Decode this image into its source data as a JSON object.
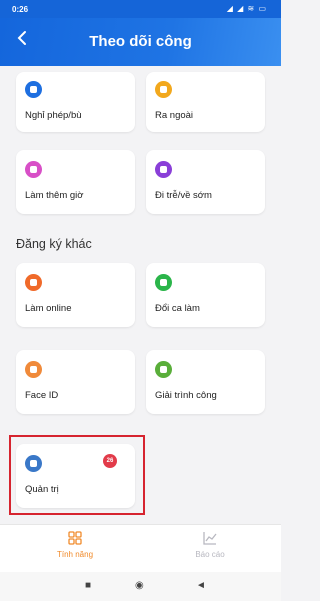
{
  "status_bar": {
    "time": "0:26",
    "icons": "signal wifi battery"
  },
  "app_bar": {
    "title": "Theo dõi công",
    "back_icon": "chevron-left-icon"
  },
  "cards": [
    {
      "label": "Nghỉ phép/bù",
      "color": "#1e6fe0"
    },
    {
      "label": "Ra ngoài",
      "color": "#f2a81d"
    },
    {
      "label": "Làm thêm giờ",
      "color": "#d84fc7"
    },
    {
      "label": "Đi trễ/về sớm",
      "color": "#8a3fd8"
    },
    {
      "label": "Làm online",
      "color": "#f06a2a"
    },
    {
      "label": "Đổi ca làm",
      "color": "#2bb54a"
    },
    {
      "label": "Face ID",
      "color": "#f08a3a"
    },
    {
      "label": "Giải trình công",
      "color": "#5aae3a"
    },
    {
      "label": "Quản trị",
      "color": "#3a78c8",
      "badge": "26"
    }
  ],
  "section": {
    "title": "Đăng ký khác"
  },
  "tabs": [
    {
      "label": "Tính năng",
      "icon": "grid-icon",
      "active": true,
      "color": "#f08a2a"
    },
    {
      "label": "Báo cáo",
      "icon": "chart-icon",
      "active": false,
      "color": "#b8b8c0"
    }
  ],
  "nav": {
    "home": "■",
    "circle": "◉",
    "back": "◄"
  }
}
